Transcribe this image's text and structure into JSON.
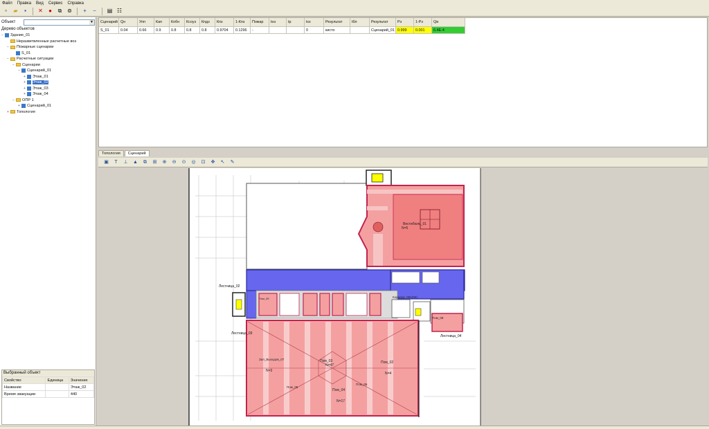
{
  "menu": [
    "Файл",
    "Правка",
    "Вид",
    "Сервис",
    "Справка"
  ],
  "left": {
    "object_label": "Объект",
    "tree_title": "Дерево объектов",
    "tree": [
      {
        "label": "Здание_01",
        "level": 0,
        "kind": "doc",
        "exp": "−"
      },
      {
        "label": "Неразветвленные расчетные воз",
        "level": 1,
        "kind": "folder",
        "exp": ""
      },
      {
        "label": "Пожарные сценарии",
        "level": 1,
        "kind": "folder",
        "exp": "−"
      },
      {
        "label": "S_01",
        "level": 2,
        "kind": "doc",
        "exp": ""
      },
      {
        "label": "Расчетные ситуации",
        "level": 1,
        "kind": "folder",
        "exp": "−"
      },
      {
        "label": "Сценарии",
        "level": 2,
        "kind": "folder",
        "exp": "−"
      },
      {
        "label": "Сценарий_01",
        "level": 3,
        "kind": "doc",
        "exp": "−"
      },
      {
        "label": "Этаж_01",
        "level": 4,
        "kind": "doc",
        "exp": "+"
      },
      {
        "label": "Этаж_02",
        "level": 4,
        "kind": "doc",
        "exp": "+",
        "selected": true
      },
      {
        "label": "Этаж_03",
        "level": 4,
        "kind": "doc",
        "exp": "+"
      },
      {
        "label": "Этаж_04",
        "level": 4,
        "kind": "doc",
        "exp": "+"
      },
      {
        "label": "ОПР 1",
        "level": 2,
        "kind": "folder",
        "exp": "−"
      },
      {
        "label": "Сценарий_01",
        "level": 3,
        "kind": "doc",
        "exp": "+"
      },
      {
        "label": "Топология",
        "level": 1,
        "kind": "folder",
        "exp": "+"
      }
    ],
    "props_title": "Выбранный объект",
    "props_headers": [
      "Свойство",
      "Единица",
      "Значение"
    ],
    "props_rows": [
      [
        "Название",
        "",
        "Этаж_02"
      ],
      [
        "Время эвакуации",
        "",
        "440"
      ]
    ]
  },
  "grid": {
    "headers": [
      "Сценарий",
      "Qн",
      "Упп",
      "Кап",
      "Кобн",
      "Ксоуэ",
      "Кпдз",
      "Кпз",
      "1-Кпз",
      "Пожар",
      "tнэ",
      "tр",
      "tск",
      "Результат",
      "tбл",
      "Результат",
      "Рэ",
      "1-Рэ",
      "Qв"
    ],
    "row": [
      "S_01",
      "0.04",
      "0.66",
      "0.9",
      "0.8",
      "0.8",
      "0.8",
      "0.9704",
      "0.1296",
      "-",
      "",
      "",
      "0",
      "кисто",
      "",
      "Сценарий_01",
      "0.999",
      "0.001",
      "6.4E-4"
    ]
  },
  "tabs": [
    "Топология",
    "Сценарий"
  ],
  "plan": {
    "labels": {
      "stair02": "Лестница_02",
      "stair04": "Лестница_04",
      "stair03": "Лестница_03",
      "room01": "Вестибюль_01",
      "n01": "N=5",
      "room07": "Зал_Выходов_07",
      "n07": "N=3",
      "room03": "Пом_03",
      "n03": "N=47",
      "room02": "Пом_02",
      "n02": "N=4",
      "room05": "Пом_05",
      "room06": "Пом_06",
      "room04": "Пом_04",
      "n04": "N=17",
      "corr": "Коридор_001(02)",
      "room_b": "Пом_09",
      "room_c": "Пом_08"
    }
  },
  "colors": {
    "room_fill": "#f4a0a0",
    "room_stroke": "#c0234f",
    "corridor": "#6666ee",
    "yellow": "#ffff00",
    "green": "#33cc33",
    "selection": "#316ac5"
  }
}
